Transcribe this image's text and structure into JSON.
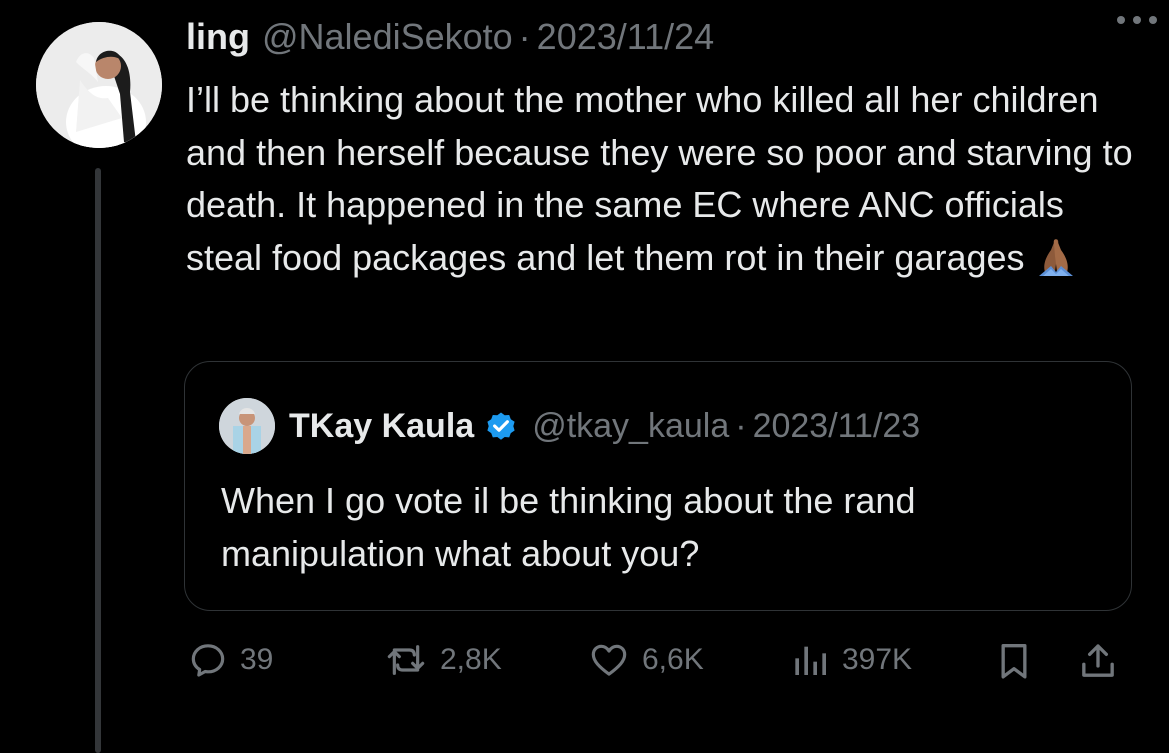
{
  "tweet": {
    "name": "ling",
    "handle": "@NalediSekoto",
    "separator": "·",
    "date": "2023/11/24",
    "text": "I’ll be thinking about the mother who killed all her children and then herself because they were so poor and starving to death. It happened in the same EC where ANC officials steal food packages and let them rot in their garages",
    "emoji": "folded-hands-emoji",
    "more_icon": "more-dots-icon"
  },
  "quote": {
    "name": "TKay Kaula",
    "verified_icon": "verified-badge-icon",
    "handle": "@tkay_kaula",
    "separator": "·",
    "date": "2023/11/23",
    "text": "When I go vote il be thinking about the rand manipulation what about you?"
  },
  "actions": {
    "replies": "39",
    "reposts": "2,8K",
    "likes": "6,6K",
    "views": "397K"
  },
  "colors": {
    "background": "#000000",
    "text": "#e7e9ea",
    "muted": "#71767b",
    "border": "#2f3336",
    "verified": "#1d9bf0"
  }
}
